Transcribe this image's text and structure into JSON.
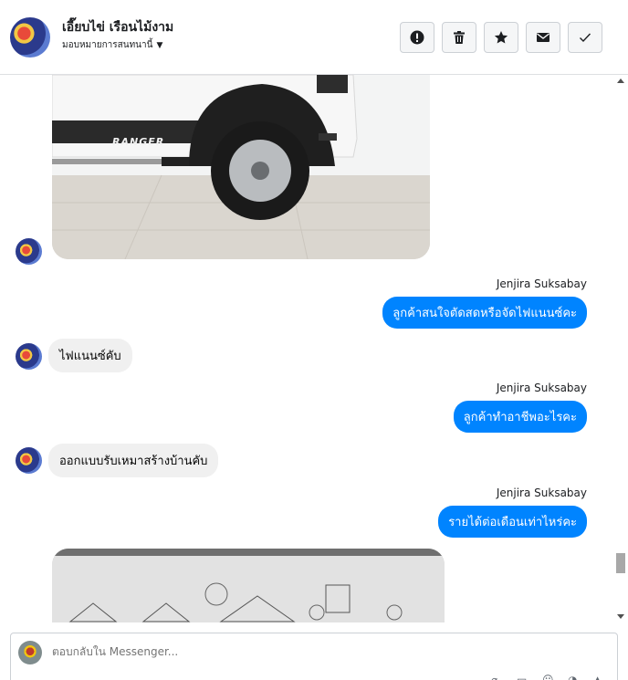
{
  "header": {
    "contact_name": "เอี๊ยบไข่ เรือนไม้งาม",
    "assign_label": "มอบหมายการสนทนานี้",
    "actions": [
      {
        "name": "mark-spam-button",
        "icon": "exclamation-icon"
      },
      {
        "name": "delete-button",
        "icon": "trash-icon"
      },
      {
        "name": "star-button",
        "icon": "star-icon"
      },
      {
        "name": "mark-unread-button",
        "icon": "envelope-icon"
      },
      {
        "name": "mark-done-button",
        "icon": "check-icon"
      }
    ]
  },
  "thread": {
    "images": [
      {
        "caption": "RANGER"
      }
    ],
    "messages": [
      {
        "sender": "Jenjira Suksabay",
        "text": "ลูกค้าสนใจตัดสดหรือจัดไฟแนนซ์คะ"
      },
      {
        "text": "ไฟแนนซ์คับ"
      },
      {
        "sender": "Jenjira Suksabay",
        "text": "ลูกค้าทำอาชีพอะไรคะ"
      },
      {
        "text": "ออกแบบรับเหมาสร้างบ้านคับ"
      },
      {
        "sender": "Jenjira Suksabay",
        "text": "รายได้ต่อเดือนเท่าไหร่คะ"
      }
    ]
  },
  "composer": {
    "placeholder": "ตอบกลับใน Messenger..."
  },
  "colors": {
    "accent": "#0084ff",
    "incoming_bubble": "#f0f0f0",
    "border": "#ccd0d5"
  }
}
